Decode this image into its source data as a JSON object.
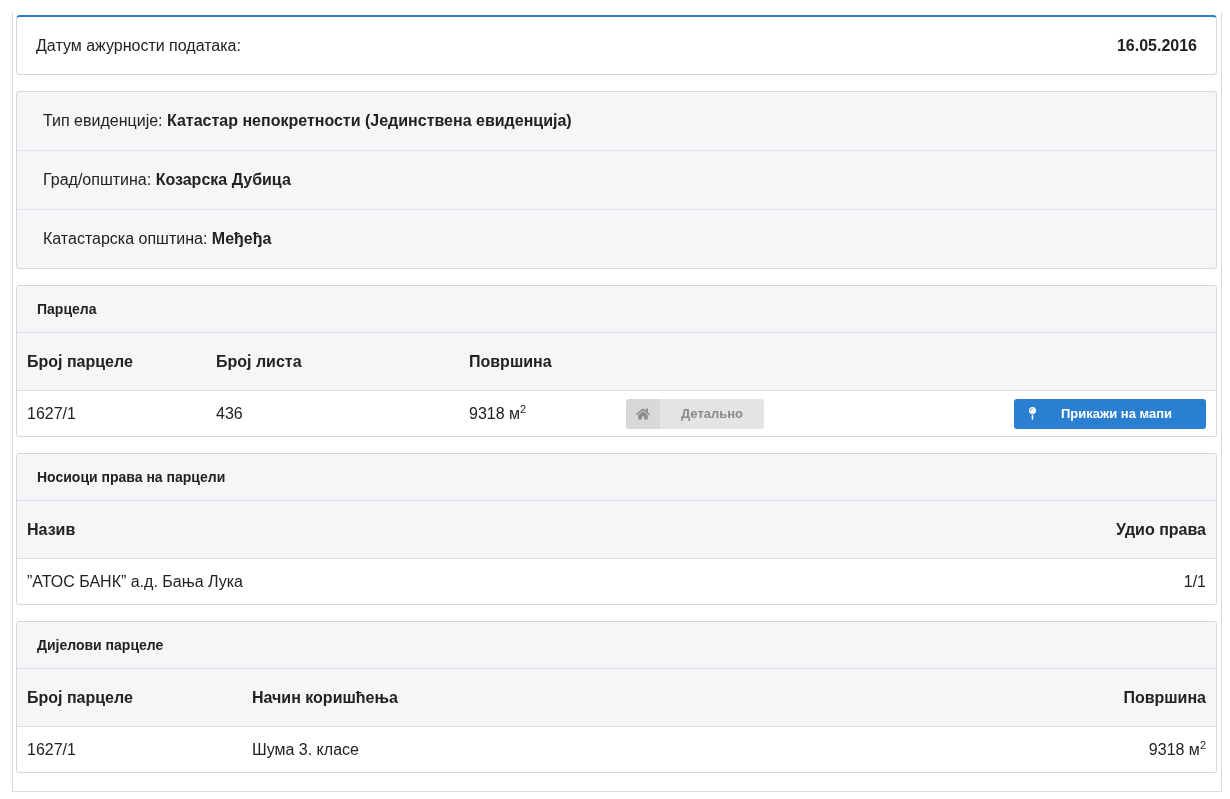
{
  "update_date": {
    "label": "Датум ажурности података:",
    "value": "16.05.2016"
  },
  "info": [
    {
      "label": "Тип евиденције:",
      "value": "Катастар непокретности (Јединствена евиденција)"
    },
    {
      "label": "Град/општина:",
      "value": "Козарска Дубица"
    },
    {
      "label": "Катастарска општина:",
      "value": "Међеђа"
    }
  ],
  "parcel": {
    "title": "Парцела",
    "columns": [
      "Број парцеле",
      "Број листа",
      "Површина"
    ],
    "rows": [
      {
        "cells": [
          "1627/1",
          "436",
          "9318 м$^{2}$"
        ],
        "details_button": {
          "label": "Детально",
          "disabled": true
        },
        "map_button": {
          "label": "Прикажи на мапи"
        }
      }
    ]
  },
  "owners": {
    "title": "Носиоци права на парцели",
    "columns": [
      "Назив",
      "Удио права"
    ],
    "rows": [
      {
        "cells": [
          "”АТОС БАНК” а.д. Бања Лука",
          "1/1"
        ]
      }
    ]
  },
  "parts": {
    "title": "Дијелови парцеле",
    "columns": [
      "Број парцеле",
      "Начин коришћења",
      "Површина"
    ],
    "rows": [
      {
        "cells": [
          "1627/1",
          "Шума 3. класе",
          "9318 м$^{2}$"
        ]
      }
    ]
  }
}
